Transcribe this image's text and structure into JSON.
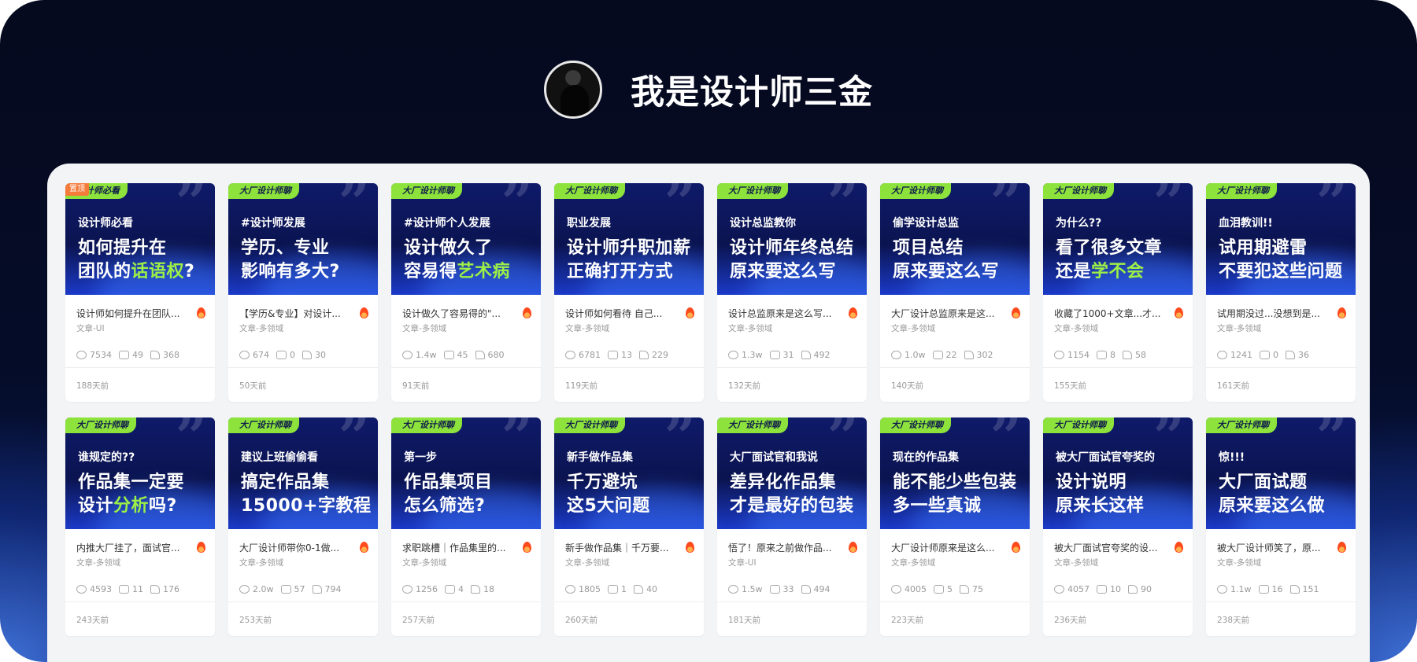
{
  "header": {
    "title": "我是设计师三金"
  },
  "pin_label": "置顶",
  "cards": [
    {
      "tag": "设计师必看",
      "pre": "设计师必看",
      "line1": "如何提升在",
      "line2a": "团队的",
      "line2hl": "话语权",
      "line2b": "?",
      "title": "设计师如何提升在团队...",
      "category": "文章-UI",
      "views": "7534",
      "comments": "49",
      "likes": "368",
      "time": "188天前"
    },
    {
      "tag": "大厂设计师聊",
      "pre": "#设计师发展",
      "line1": "学历、专业",
      "line2a": "影响有多大?",
      "line2hl": "",
      "line2b": "",
      "title": "【学历&专业】对设计...",
      "category": "文章-多领域",
      "views": "674",
      "comments": "0",
      "likes": "30",
      "time": "50天前"
    },
    {
      "tag": "大厂设计师聊",
      "pre": "#设计师个人发展",
      "line1": "设计做久了",
      "line2a": "容易得",
      "line2hl": "艺术病",
      "line2b": "",
      "title": "设计做久了容易得的\"...",
      "category": "文章-多领域",
      "views": "1.4w",
      "comments": "45",
      "likes": "680",
      "time": "91天前"
    },
    {
      "tag": "大厂设计师聊",
      "pre": "职业发展",
      "line1": "设计师升职加薪",
      "line2a": "正确打开方式",
      "line2hl": "",
      "line2b": "",
      "title": "设计师如何看待 自己...",
      "category": "文章-多领域",
      "views": "6781",
      "comments": "13",
      "likes": "229",
      "time": "119天前"
    },
    {
      "tag": "大厂设计师聊",
      "pre": "设计总监教你",
      "line1": "设计师年终总结",
      "line2a": "原来要这么写",
      "line2hl": "",
      "line2b": "",
      "title": "设计总监原来是这么写...",
      "category": "文章-多领域",
      "views": "1.3w",
      "comments": "31",
      "likes": "492",
      "time": "132天前"
    },
    {
      "tag": "大厂设计师聊",
      "pre": "偷学设计总监",
      "line1": "项目总结",
      "line2a": "原来要这么写",
      "line2hl": "",
      "line2b": "",
      "title": "大厂设计总监原来是这...",
      "category": "文章-多领域",
      "views": "1.0w",
      "comments": "22",
      "likes": "302",
      "time": "140天前"
    },
    {
      "tag": "大厂设计师聊",
      "pre": "为什么??",
      "line1": "看了很多文章",
      "line2a": "还是",
      "line2hl": "学不会",
      "line2b": "",
      "title": "收藏了1000+文章...才...",
      "category": "文章-多领域",
      "views": "1154",
      "comments": "8",
      "likes": "58",
      "time": "155天前"
    },
    {
      "tag": "大厂设计师聊",
      "pre": "血泪教训!!",
      "line1": "试用期避雷",
      "line2a": "不要犯这些问题",
      "line2hl": "",
      "line2b": "",
      "title": "试用期没过...没想到是...",
      "category": "文章-多领域",
      "views": "1241",
      "comments": "0",
      "likes": "36",
      "time": "161天前"
    },
    {
      "tag": "大厂设计师聊",
      "pre": "谁规定的??",
      "line1": "作品集一定要",
      "line2a": "设计",
      "line2hl": "分析",
      "line2b": "吗?",
      "title": "内推大厂挂了，面试官...",
      "category": "文章-多领域",
      "views": "4593",
      "comments": "11",
      "likes": "176",
      "time": "243天前"
    },
    {
      "tag": "大厂设计师聊",
      "pre": "建议上班偷偷看",
      "line1": "搞定作品集",
      "line2a": "15000+字教程",
      "line2hl": "",
      "line2b": "",
      "title": "大厂设计师带你0-1做...",
      "category": "文章-多领域",
      "views": "2.0w",
      "comments": "57",
      "likes": "794",
      "time": "253天前"
    },
    {
      "tag": "大厂设计师聊",
      "pre": "第一步",
      "line1": "作品集项目",
      "line2a": "怎么筛选?",
      "line2hl": "",
      "line2b": "",
      "title": "求职跳槽｜作品集里的...",
      "category": "文章-多领域",
      "views": "1256",
      "comments": "4",
      "likes": "18",
      "time": "257天前"
    },
    {
      "tag": "大厂设计师聊",
      "pre": "新手做作品集",
      "line1": "千万避坑",
      "line2a": "这5大问题",
      "line2hl": "",
      "line2b": "",
      "title": "新手做作品集｜千万要...",
      "category": "文章-多领域",
      "views": "1805",
      "comments": "1",
      "likes": "40",
      "time": "260天前"
    },
    {
      "tag": "大厂设计师聊",
      "pre": "大厂面试官和我说",
      "line1": "差异化作品集",
      "line2a": "才是最好的包装",
      "line2hl": "",
      "line2b": "",
      "title": "悟了！原来之前做作品...",
      "category": "文章-UI",
      "views": "1.5w",
      "comments": "33",
      "likes": "494",
      "time": "181天前"
    },
    {
      "tag": "大厂设计师聊",
      "pre": "现在的作品集",
      "line1": "能不能少些包装",
      "line2a": "多一些真诚",
      "line2hl": "",
      "line2b": "",
      "title": "大厂设计师原来是这么...",
      "category": "文章-多领域",
      "views": "4005",
      "comments": "5",
      "likes": "75",
      "time": "223天前"
    },
    {
      "tag": "大厂设计师聊",
      "pre": "被大厂面试官夸奖的",
      "line1": "设计说明",
      "line2a": "原来长这样",
      "line2hl": "",
      "line2b": "",
      "title": "被大厂面试官夸奖的设...",
      "category": "文章-多领域",
      "views": "4057",
      "comments": "10",
      "likes": "90",
      "time": "236天前"
    },
    {
      "tag": "大厂设计师聊",
      "pre": "惊!!!",
      "line1": "大厂面试题",
      "line2a": "原来要这么做",
      "line2hl": "",
      "line2b": "",
      "title": "被大厂设计师笑了，原...",
      "category": "文章-多领域",
      "views": "1.1w",
      "comments": "16",
      "likes": "151",
      "time": "238天前"
    }
  ]
}
